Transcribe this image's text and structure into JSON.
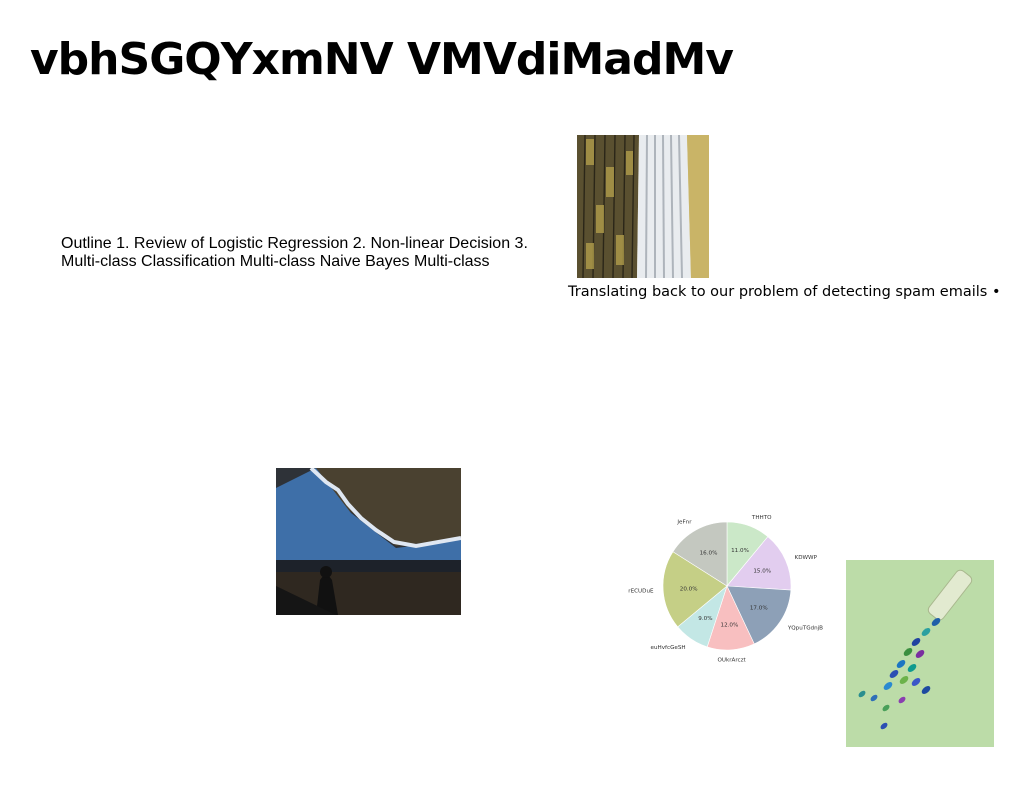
{
  "slide": {
    "title": "vbhSGQYxmNV VMVdiMadMv",
    "outline_text": "Outline 1. Review of Logistic Regression 2. Non-linear Decision 3. Multi-class Classification Multi-class Naive Bayes Multi-class",
    "caption_text": "Translating back to our problem of detecting spam emails •"
  },
  "colors": {
    "background": "#ffffff",
    "text": "#000000"
  },
  "chart_data": {
    "type": "pie",
    "labels": [
      "THHTO",
      "KDWWP",
      "YQpuTGdnjB",
      "OUkrArczt",
      "euHvfcGeSH",
      "rECUDuE",
      "JeFnr"
    ],
    "values": [
      11.0,
      15.0,
      17.0,
      12.0,
      9.0,
      20.0,
      16.0
    ],
    "value_labels": [
      "11.0%",
      "15.0%",
      "17.0%",
      "12.0%",
      "9.0%",
      "20.0%",
      "16.0%"
    ],
    "colors": [
      "#cbe8c8",
      "#e2cdef",
      "#8da0b7",
      "#f8bfc0",
      "#c3e7e5",
      "#c5cf86",
      "#c4c8c0"
    ],
    "start_angle_deg": 90,
    "direction": "clockwise",
    "legend": "none"
  }
}
